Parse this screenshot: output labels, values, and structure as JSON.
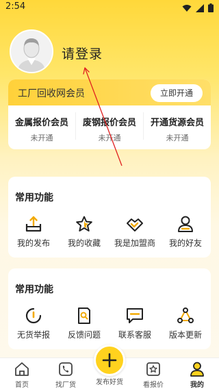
{
  "status_bar": {
    "time": "2:54"
  },
  "profile": {
    "login_text": "请登录"
  },
  "member": {
    "title": "工厂回收网会员",
    "open_button": "立即开通",
    "tiers": [
      {
        "name": "金属报价会员",
        "status": "未开通"
      },
      {
        "name": "废钢报价会员",
        "status": "未开通"
      },
      {
        "name": "开通货源会员",
        "status": "未开通"
      }
    ]
  },
  "functions_1": {
    "title": "常用功能",
    "items": [
      {
        "label": "我的发布",
        "icon": "upload-tray-icon"
      },
      {
        "label": "我的收藏",
        "icon": "star-icon"
      },
      {
        "label": "我是加盟商",
        "icon": "handshake-icon"
      },
      {
        "label": "我的好友",
        "icon": "person-icon"
      }
    ]
  },
  "functions_2": {
    "title": "常用功能",
    "items": [
      {
        "label": "无货举报",
        "icon": "report-icon"
      },
      {
        "label": "反馈问题",
        "icon": "feedback-icon"
      },
      {
        "label": "联系客服",
        "icon": "message-icon"
      },
      {
        "label": "版本更新",
        "icon": "update-icon"
      }
    ]
  },
  "tab_bar": {
    "items": [
      {
        "label": "首页",
        "icon": "home-icon"
      },
      {
        "label": "找厂货",
        "icon": "phone-icon"
      },
      {
        "label": "发布好货",
        "icon": "plus-icon"
      },
      {
        "label": "看报价",
        "icon": "star-box-icon"
      },
      {
        "label": "我的",
        "icon": "user-icon"
      }
    ],
    "active": "我的"
  },
  "colors": {
    "accent": "#ffd21e",
    "dark": "#222222"
  }
}
